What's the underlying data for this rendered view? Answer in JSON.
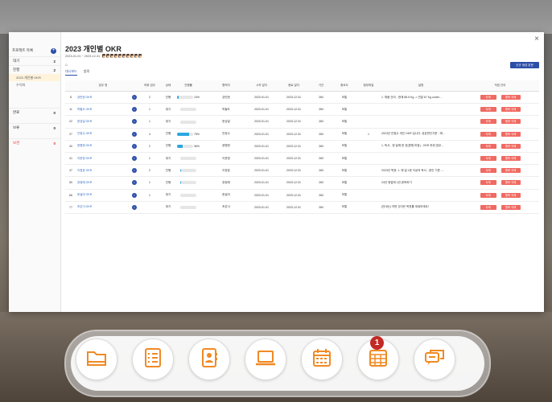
{
  "window": {
    "title": "2023 개인별 OKR",
    "period": "2023-01-01 ~ 2023-12-31",
    "close_label": "×"
  },
  "sidebar": {
    "header": "프로젝트 목록",
    "categories": [
      {
        "label": "대기",
        "count": "2"
      },
      {
        "label": "진행",
        "count": "2"
      },
      {
        "label": "완료",
        "count": "0"
      },
      {
        "label": "보류",
        "count": "0"
      },
      {
        "label": "보관",
        "count": "0"
      }
    ],
    "sub_items": [
      "2023 개인별 OKR",
      "수익화"
    ]
  },
  "tabs": [
    "대시보드",
    "범례"
  ],
  "new_button": "신규 생성 본문",
  "table": {
    "headers": [
      "",
      "업무 명",
      "",
      "하위 업무",
      "상태",
      "진행률",
      "",
      "협력자",
      "시작 일자",
      "종료 일자",
      "기간",
      "중요도",
      "첨부파일",
      "설명",
      "작업 관리"
    ],
    "rows": [
      {
        "n": "8",
        "name": "강민헌 OKR",
        "sub": "2",
        "status": "진행",
        "pct": "10%",
        "fill": 0.1,
        "who": "강민헌",
        "start": "2023-01-01",
        "end": "2023-12-31",
        "days": "260",
        "prio": "보통",
        "att": "",
        "desc": "1. 체중 관리 - 현재 88.5 Kg -> 연말 67 Kg under...",
        "b1": "삭제",
        "b2": "멤버 삭제"
      },
      {
        "n": "11",
        "name": "박필도 OKR",
        "sub": "1",
        "status": "대기",
        "pct": "",
        "fill": 0,
        "who": "박필도",
        "start": "2023-01-01",
        "end": "2023-12-31",
        "days": "260",
        "prio": "보통",
        "att": "",
        "desc": "",
        "b1": "삭제",
        "b2": "멤버 삭제"
      },
      {
        "n": "22",
        "name": "한성일 OKR",
        "sub": "1",
        "status": "대기",
        "pct": "",
        "fill": 0,
        "who": "한성일",
        "start": "2023-01-01",
        "end": "2023-12-31",
        "days": "260",
        "prio": "보통",
        "att": "",
        "desc": "",
        "b1": "삭제",
        "b2": "멤버 삭제"
      },
      {
        "n": "27",
        "name": "안정수 OKR",
        "sub": "4",
        "status": "진행",
        "pct": "75%",
        "fill": 0.75,
        "who": "안정수",
        "start": "2023-01-01",
        "end": "2023-12-31",
        "days": "260",
        "prio": "보통",
        "att": "1",
        "desc": "2023년 안정수 개인 OKR 입니다. 성공판단기준 - 매...",
        "b1": "삭제",
        "b2": "멤버 삭제"
      },
      {
        "n": "40",
        "name": "윤병현 OKR",
        "sub": "2",
        "status": "진행",
        "pct": "36%",
        "fill": 0.36,
        "who": "윤병현",
        "start": "2023-01-01",
        "end": "2023-12-31",
        "days": "260",
        "prio": "보통",
        "att": "",
        "desc": "1. 독서 - 한 달에 한 권(총원 미정) - OKR 하위 업무...",
        "b1": "삭제",
        "b2": "멤버 삭제"
      },
      {
        "n": "41",
        "name": "이문정 OKR",
        "sub": "1",
        "status": "대기",
        "pct": "",
        "fill": 0,
        "who": "이문정",
        "start": "2023-01-01",
        "end": "2023-12-31",
        "days": "260",
        "prio": "보통",
        "att": "",
        "desc": "",
        "b1": "삭제",
        "b2": "멤버 삭제"
      },
      {
        "n": "47",
        "name": "이정호 OKR",
        "sub": "2",
        "status": "진행",
        "pct": "",
        "fill": 0.08,
        "who": "이정호",
        "start": "2023-01-01",
        "end": "2023-12-31",
        "days": "260",
        "prio": "보통",
        "att": "",
        "desc": "2023년 목표: 1. 매 일 1문 이상의 독서 - 완인 기준 -...",
        "b1": "삭제",
        "b2": "멤버 삭제"
      },
      {
        "n": "50",
        "name": "장정애 OKR",
        "sub": "1",
        "status": "진행",
        "pct": "",
        "fill": 0.05,
        "who": "장정애",
        "start": "2023-01-01",
        "end": "2023-12-31",
        "days": "260",
        "prio": "보통",
        "att": "",
        "desc": "23년 현업에 1권 완독하기",
        "b1": "삭제",
        "b2": "멤버 삭제"
      },
      {
        "n": "66",
        "name": "한설아 OKR",
        "sub": "1",
        "status": "대기",
        "pct": "",
        "fill": 0,
        "who": "한설아",
        "start": "2023-01-01",
        "end": "2023-12-31",
        "days": "260",
        "prio": "보통",
        "att": "",
        "desc": "",
        "b1": "삭제",
        "b2": "멤버 삭제"
      },
      {
        "n": "77",
        "name": "조은식 OKR",
        "sub": "",
        "status": "대기",
        "pct": "",
        "fill": 0,
        "who": "조은식",
        "start": "2023-01-01",
        "end": "2023-12-31",
        "days": "260",
        "prio": "보통",
        "att": "",
        "desc": "(안내는) 어떤 것이든 목표를 세워보세요!",
        "b1": "삭제",
        "b2": "멤버 삭제"
      }
    ]
  },
  "dock": {
    "items": [
      "folder-icon",
      "checklist-icon",
      "contacts-icon",
      "laptop-icon",
      "calendar-icon",
      "schedule-icon",
      "chat-icon"
    ],
    "badge": "1",
    "accent": "#f08a24"
  }
}
